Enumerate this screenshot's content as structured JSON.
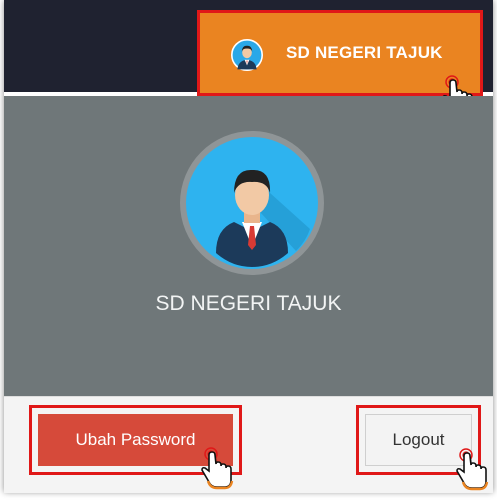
{
  "header": {
    "user_menu_label": "SD NEGERI TAJUK",
    "avatar_icon": "user-avatar-icon"
  },
  "profile_panel": {
    "name": "SD NEGERI TAJUK",
    "avatar_icon": "user-avatar-icon"
  },
  "footer": {
    "change_password_label": "Ubah Password",
    "logout_label": "Logout"
  },
  "colors": {
    "topbar": "#1f2230",
    "accent_orange": "#ea8421",
    "panel_gray": "#6f7779",
    "highlight_red": "#e01818",
    "danger_button": "#d64a3a"
  },
  "annotations": {
    "cursor_icon": "hand-pointer-icon"
  }
}
